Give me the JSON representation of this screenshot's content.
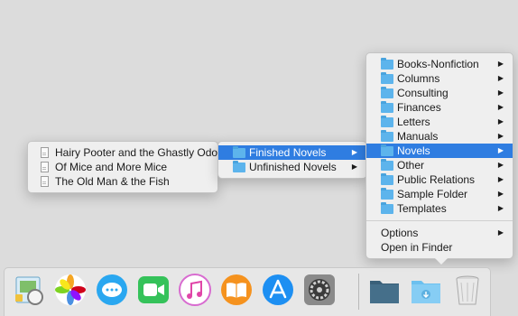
{
  "main_menu": {
    "folders": [
      {
        "label": "Books-Nonfiction",
        "selected": false
      },
      {
        "label": "Columns",
        "selected": false
      },
      {
        "label": "Consulting",
        "selected": false
      },
      {
        "label": "Finances",
        "selected": false
      },
      {
        "label": "Letters",
        "selected": false
      },
      {
        "label": "Manuals",
        "selected": false
      },
      {
        "label": "Novels",
        "selected": true
      },
      {
        "label": "Other",
        "selected": false
      },
      {
        "label": "Public Relations",
        "selected": false
      },
      {
        "label": "Sample Folder",
        "selected": false
      },
      {
        "label": "Templates",
        "selected": false
      }
    ],
    "options_label": "Options",
    "open_in_finder_label": "Open in Finder",
    "submenu_arrow": "▶"
  },
  "novels_menu": {
    "folders": [
      {
        "label": "Finished Novels",
        "selected": true
      },
      {
        "label": "Unfinished Novels",
        "selected": false
      }
    ]
  },
  "files_menu": {
    "files": [
      {
        "label": "Hairy Pooter and the Ghastly Odor"
      },
      {
        "label": "Of Mice and More Mice"
      },
      {
        "label": "The Old Man & the Fish"
      }
    ]
  },
  "dock": {
    "items": [
      "preview-icon",
      "photos-icon",
      "messages-icon",
      "facetime-icon",
      "itunes-icon",
      "ibooks-icon",
      "app-store-icon",
      "system-preferences-icon",
      "documents-folder-icon",
      "downloads-folder-icon",
      "trash-icon"
    ]
  },
  "colors": {
    "selection": "#2f7de1",
    "folder": "#5db4ec",
    "desktop": "#dcdcdc"
  }
}
